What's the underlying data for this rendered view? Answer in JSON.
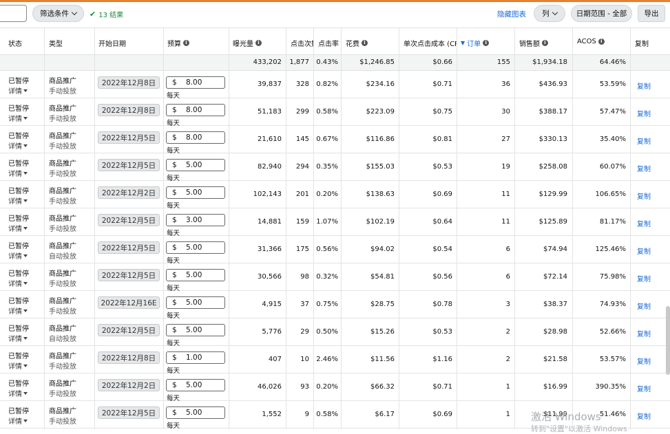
{
  "toolbar": {
    "filter_label": "筛选条件",
    "result_label": "13 结果",
    "hide_chart": "隐藏图表",
    "columns_label": "列",
    "date_range_label": "日期范围 - 全部",
    "export_label": "导出"
  },
  "columns": {
    "status": "状态",
    "type": "类型",
    "start_date": "开始日期",
    "budget": "预算",
    "impressions": "曝光量",
    "clicks": "点击次数",
    "ctr": "点击率 (",
    "spend": "花费",
    "cpc": "单次点击成本 (CPC",
    "orders": "订单",
    "sales": "销售额",
    "acos": "ACOS",
    "copy": "复制"
  },
  "totals": {
    "impressions": "433,202",
    "clicks": "1,877",
    "ctr": "0.43%",
    "spend": "$1,246.85",
    "cpc": "$0.66",
    "orders": "155",
    "sales": "$1,934.18",
    "acos": "64.46%"
  },
  "labels": {
    "detail": "详情",
    "per_day": "每天",
    "currency": "$",
    "copy": "复制"
  },
  "rows": [
    {
      "status": "已暂停",
      "type": "商品推广",
      "targeting": "手动投放",
      "date": "2022年12月8日",
      "budget": "8.00",
      "impressions": "39,837",
      "clicks": "328",
      "ctr": "0.82%",
      "spend": "$234.16",
      "cpc": "$0.71",
      "orders": "36",
      "sales": "$436.93",
      "acos": "53.59%"
    },
    {
      "status": "已暂停",
      "type": "商品推广",
      "targeting": "手动投放",
      "date": "2022年12月8日",
      "budget": "8.00",
      "impressions": "51,183",
      "clicks": "299",
      "ctr": "0.58%",
      "spend": "$223.09",
      "cpc": "$0.75",
      "orders": "30",
      "sales": "$388.17",
      "acos": "57.47%"
    },
    {
      "status": "已暂停",
      "type": "商品推广",
      "targeting": "手动投放",
      "date": "2022年12月5日",
      "budget": "8.00",
      "impressions": "21,610",
      "clicks": "145",
      "ctr": "0.67%",
      "spend": "$116.86",
      "cpc": "$0.81",
      "orders": "27",
      "sales": "$330.13",
      "acos": "35.40%"
    },
    {
      "status": "已暂停",
      "type": "商品推广",
      "targeting": "手动投放",
      "date": "2022年12月5日",
      "budget": "5.00",
      "impressions": "82,940",
      "clicks": "294",
      "ctr": "0.35%",
      "spend": "$155.03",
      "cpc": "$0.53",
      "orders": "19",
      "sales": "$258.08",
      "acos": "60.07%"
    },
    {
      "status": "已暂停",
      "type": "商品推广",
      "targeting": "手动投放",
      "date": "2022年12月2日",
      "budget": "5.00",
      "impressions": "102,143",
      "clicks": "201",
      "ctr": "0.20%",
      "spend": "$138.63",
      "cpc": "$0.69",
      "orders": "11",
      "sales": "$129.99",
      "acos": "106.65%"
    },
    {
      "status": "已暂停",
      "type": "商品推广",
      "targeting": "手动投放",
      "date": "2022年12月5日",
      "budget": "3.00",
      "impressions": "14,881",
      "clicks": "159",
      "ctr": "1.07%",
      "spend": "$102.19",
      "cpc": "$0.64",
      "orders": "11",
      "sales": "$125.89",
      "acos": "81.17%"
    },
    {
      "status": "已暂停",
      "type": "商品推广",
      "targeting": "自动投放",
      "date": "2022年12月5日",
      "budget": "5.00",
      "impressions": "31,366",
      "clicks": "175",
      "ctr": "0.56%",
      "spend": "$94.02",
      "cpc": "$0.54",
      "orders": "6",
      "sales": "$74.94",
      "acos": "125.46%"
    },
    {
      "status": "已暂停",
      "type": "商品推广",
      "targeting": "手动投放",
      "date": "2022年12月5日",
      "budget": "5.00",
      "impressions": "30,566",
      "clicks": "98",
      "ctr": "0.32%",
      "spend": "$54.81",
      "cpc": "$0.56",
      "orders": "6",
      "sales": "$72.14",
      "acos": "75.98%"
    },
    {
      "status": "已暂停",
      "type": "商品推广",
      "targeting": "手动投放",
      "date": "2022年12月16E",
      "budget": "5.00",
      "impressions": "4,915",
      "clicks": "37",
      "ctr": "0.75%",
      "spend": "$28.75",
      "cpc": "$0.78",
      "orders": "3",
      "sales": "$38.37",
      "acos": "74.93%"
    },
    {
      "status": "已暂停",
      "type": "商品推广",
      "targeting": "自动投放",
      "date": "2022年12月5日",
      "budget": "5.00",
      "impressions": "5,776",
      "clicks": "29",
      "ctr": "0.50%",
      "spend": "$15.26",
      "cpc": "$0.53",
      "orders": "2",
      "sales": "$28.98",
      "acos": "52.66%"
    },
    {
      "status": "已暂停",
      "type": "商品推广",
      "targeting": "手动投放",
      "date": "2022年12月8日",
      "budget": "1.00",
      "impressions": "407",
      "clicks": "10",
      "ctr": "2.46%",
      "spend": "$11.56",
      "cpc": "$1.16",
      "orders": "2",
      "sales": "$21.58",
      "acos": "53.57%"
    },
    {
      "status": "已暂停",
      "type": "商品推广",
      "targeting": "手动投放",
      "date": "2022年12月2日",
      "budget": "5.00",
      "impressions": "46,026",
      "clicks": "93",
      "ctr": "0.20%",
      "spend": "$66.32",
      "cpc": "$0.71",
      "orders": "1",
      "sales": "$16.99",
      "acos": "390.35%"
    },
    {
      "status": "已暂停",
      "type": "商品推广",
      "targeting": "手动投放",
      "date": "2022年12月5日",
      "budget": "5.00",
      "impressions": "1,552",
      "clicks": "9",
      "ctr": "0.58%",
      "spend": "$6.17",
      "cpc": "$0.69",
      "orders": "1",
      "sales": "$11.99",
      "acos": "51.46%"
    }
  ],
  "watermark": {
    "line1": "激活 Windows",
    "line2": "转到\"设置\"以激活 Windows"
  }
}
